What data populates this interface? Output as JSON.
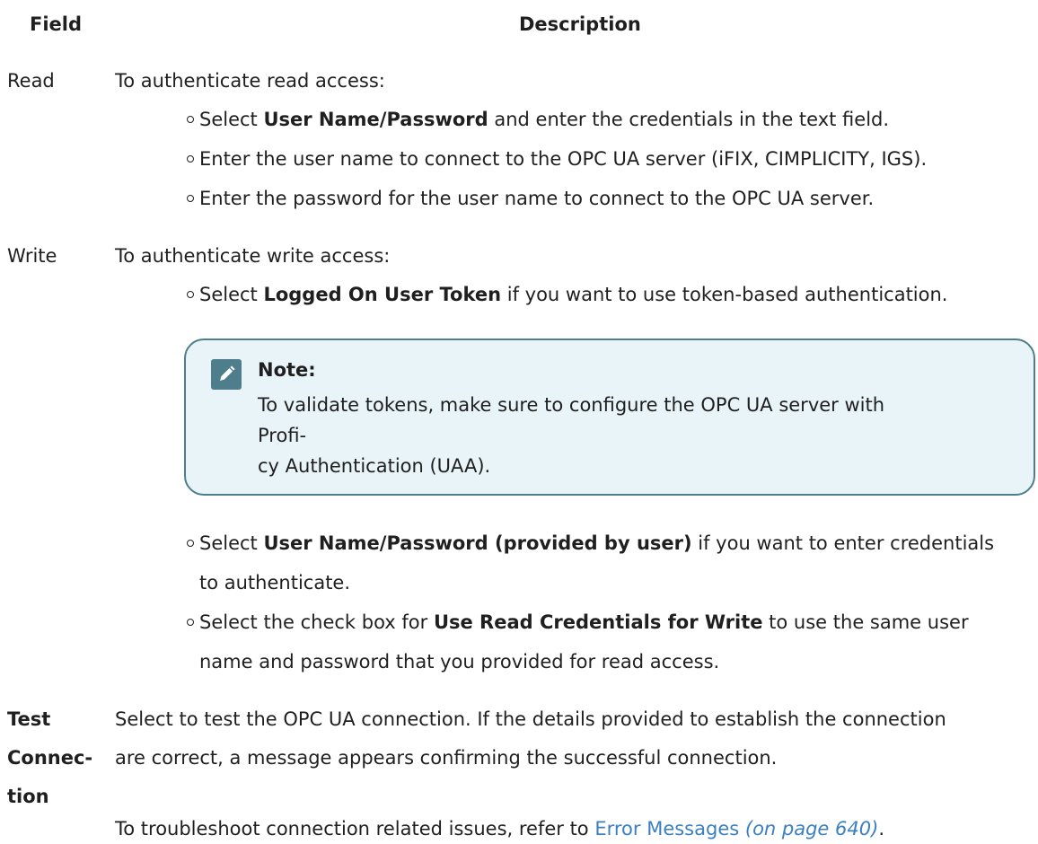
{
  "header": {
    "field": "Field",
    "description": "Description"
  },
  "rows": {
    "read": {
      "field": "Read",
      "intro": "To authenticate read access:",
      "bullets": [
        {
          "pre": "Select ",
          "bold": "User Name/Password",
          "post": " and enter the credentials in the text field."
        },
        {
          "text": "Enter the user name to connect to the OPC UA server (iFIX, CIMPLICITY, IGS)."
        },
        {
          "text": "Enter the password for the user name to connect to the OPC UA server."
        }
      ]
    },
    "write": {
      "field": "Write",
      "intro": "To authenticate write access:",
      "bullet1": {
        "pre": "Select ",
        "bold": "Logged On User Token",
        "post": " if you want to use token-based authentication."
      },
      "note": {
        "icon": "pencil-icon",
        "title": "Note:",
        "line1": "To validate tokens, make sure to configure the OPC UA server with Profi-",
        "line2": "cy Authentication (UAA)."
      },
      "bullet2": {
        "pre": "Select ",
        "bold": "User Name/Password (provided by user)",
        "post": " if you want to enter credentials",
        "line2": "to authenticate."
      },
      "bullet3": {
        "pre": "Select the check box for ",
        "bold": "Use Read Credentials for Write",
        "post": " to use the same user",
        "line2": "name and password that you provided for read access."
      }
    },
    "test": {
      "field_line1": "Test",
      "field_line2": "Connec-",
      "field_line3": "tion",
      "desc_line1": "Select to test the OPC UA connection. If the details provided to establish the connection",
      "desc_line2": "are correct, a message appears confirming the successful connection.",
      "trouble_pre": "To troubleshoot connection related issues, refer to ",
      "link_text": "Error Messages",
      "link_page": "(on page 640)",
      "trouble_post": "."
    }
  },
  "colors": {
    "text": "#1f1f1f",
    "link": "#3a7fc0",
    "note_bg": "#e8f4f7",
    "note_border": "#4e7e8c"
  }
}
